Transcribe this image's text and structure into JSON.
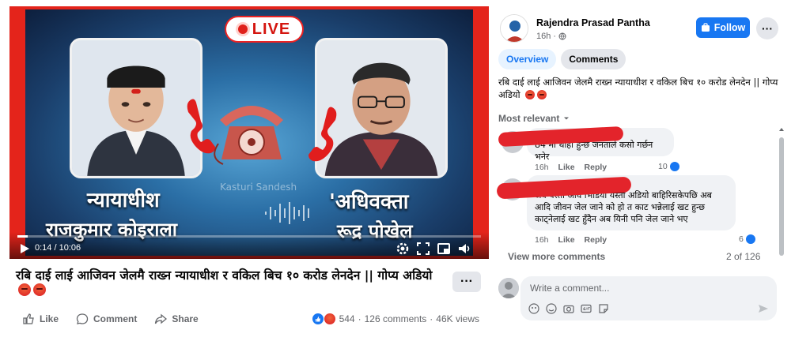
{
  "video": {
    "live_label": "LIVE",
    "caption_left_title": "न्यायाधीश",
    "caption_left_name": "राजकुमार कोइराला",
    "caption_right_title": "'अधिवक्ता",
    "caption_right_name": "रूद्र पोखेल",
    "watermark": "Kasturi Sandesh",
    "time": "0:14 / 10:06",
    "progress": 0.023
  },
  "post": {
    "title": "रबि दाई लाई आजिवन जेलमै राख्न न्यायाधीश र वकिल बिच १० करोड लेनदेन || गोप्य अडियो",
    "more_label": "···",
    "actions": {
      "like": "Like",
      "comment": "Comment",
      "share": "Share"
    },
    "stats": {
      "reactions": "544",
      "comments": "126 comments",
      "views": "46K views"
    }
  },
  "sidebar": {
    "author": "Rajendra Prasad Pantha",
    "time": "16h",
    "follow_label": "Follow",
    "more_label": "···",
    "tabs": [
      {
        "label": "Overview"
      },
      {
        "label": "Comments"
      }
    ],
    "description": "रबि दाई लाई आजिवन जेलमै राख्न न्यायाधीश र वकिल बिच १० करोड लेनदेन || गोप्य अडियो",
    "sort_label": "Most relevant",
    "comments": [
      {
        "text": "84 मा थाहा हुन्छ जनताले कसो गर्छन भनेर",
        "time": "16h",
        "like": "Like",
        "reply": "Reply",
        "likes": "10"
      },
      {
        "text": "अब यस्तो अघि भिडियो यस्तो अडियो बाहिरिसकेपछि अब आदि जीवन जेल जाने को हो त काट भन्नेलाई खट हुन्छ काट्नेलाई खट हुँदैन अब यिनी पनि जेल जाने भए",
        "time": "16h",
        "like": "Like",
        "reply": "Reply",
        "likes": "6"
      }
    ],
    "view_more": "View more comments",
    "count": "2 of 126",
    "composer_placeholder": "Write a comment..."
  },
  "colors": {
    "accent": "#1877f2",
    "video_border": "#e4241b",
    "redaction": "#e3242b"
  }
}
